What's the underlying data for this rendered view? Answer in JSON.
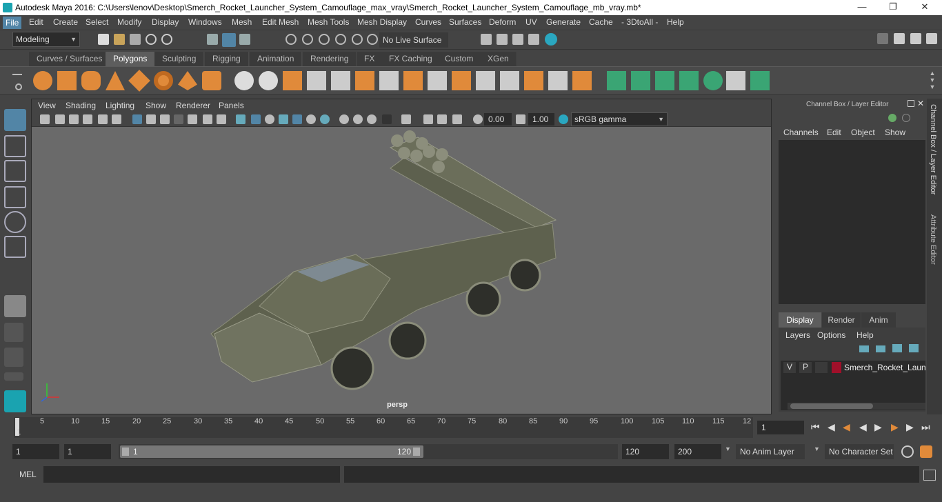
{
  "window": {
    "title": "Autodesk Maya 2016: C:\\Users\\lenov\\Desktop\\Smerch_Rocket_Launcher_System_Camouflage_max_vray\\Smerch_Rocket_Launcher_System_Camouflage_mb_vray.mb*"
  },
  "menubar": [
    "File",
    "Edit",
    "Create",
    "Select",
    "Modify",
    "Display",
    "Windows",
    "Mesh",
    "Edit Mesh",
    "Mesh Tools",
    "Mesh Display",
    "Curves",
    "Surfaces",
    "Deform",
    "UV",
    "Generate",
    "Cache",
    "- 3DtoAll -",
    "Help"
  ],
  "status": {
    "mode": "Modeling",
    "live_surface": "No Live Surface"
  },
  "shelf_tabs": [
    "Curves / Surfaces",
    "Polygons",
    "Sculpting",
    "Rigging",
    "Animation",
    "Rendering",
    "FX",
    "FX Caching",
    "Custom",
    "XGen"
  ],
  "shelf_active": "Polygons",
  "viewport": {
    "menus": [
      "View",
      "Shading",
      "Lighting",
      "Show",
      "Renderer",
      "Panels"
    ],
    "exposure": "0.00",
    "gamma": "1.00",
    "color_space": "sRGB gamma",
    "camera_label": "persp"
  },
  "channel_box": {
    "title": "Channel Box / Layer Editor",
    "menus": [
      "Channels",
      "Edit",
      "Object",
      "Show"
    ],
    "layer_tabs": [
      "Display",
      "Render",
      "Anim"
    ],
    "layer_menus": [
      "Layers",
      "Options",
      "Help"
    ],
    "layer": {
      "v": "V",
      "p": "P",
      "name": "Smerch_Rocket_Launcl",
      "color": "#a0102a"
    }
  },
  "side_tabs": [
    "Channel Box / Layer Editor",
    "Attribute Editor"
  ],
  "timeline": {
    "ticks": [
      "5",
      "10",
      "15",
      "20",
      "25",
      "30",
      "35",
      "40",
      "45",
      "50",
      "55",
      "60",
      "65",
      "70",
      "75",
      "80",
      "85",
      "90",
      "95",
      "100",
      "105",
      "110",
      "115",
      "12"
    ],
    "start_marker": "1",
    "current_frame": "1"
  },
  "range": {
    "start": "1",
    "inner_start": "1",
    "slider_start": "1",
    "slider_end": "120",
    "end": "120",
    "total_end": "200",
    "anim_layer": "No Anim Layer",
    "char_set": "No Character Set"
  },
  "cmd": {
    "label": "MEL"
  }
}
